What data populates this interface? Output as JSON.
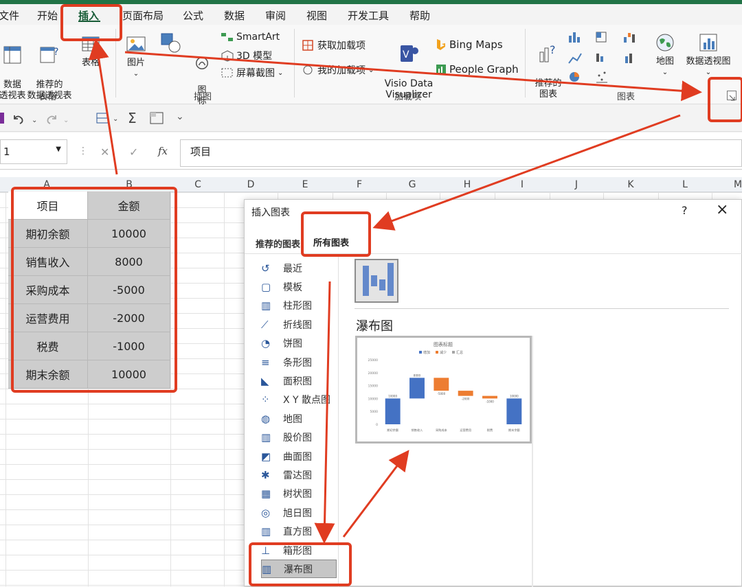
{
  "ribbon_tabs": [
    "文件",
    "开始",
    "插入",
    "页面布局",
    "公式",
    "数据",
    "审阅",
    "视图",
    "开发工具",
    "帮助"
  ],
  "active_tab": "插入",
  "ribbon": {
    "tables_group": {
      "label": "表格",
      "pivot_label": "数据\n透视表",
      "recommended_pivot_label": "推荐的\n数据透视表",
      "table_label": "表格"
    },
    "illustrations_group": {
      "label": "插图",
      "picture_label": "图片",
      "icons_label": "图\n标",
      "smartart": "SmartArt",
      "model3d": "3D 模型",
      "screenshot": "屏幕截图"
    },
    "addins_group": {
      "label": "加载项",
      "get_addins": "获取加载项",
      "my_addins": "我的加载项",
      "visio_label": "Visio Data\nVisualizer",
      "bing_maps": "Bing Maps",
      "people_graph": "People Graph"
    },
    "charts_group": {
      "label": "图表",
      "recommended_charts": "推荐的\n图表",
      "map_label": "地图",
      "pivot_chart_label": "数据透视图"
    }
  },
  "quick_access": {
    "sum_symbol": "Σ"
  },
  "formula_bar": {
    "name_box": "1",
    "fx_label": "fx",
    "content": "项目"
  },
  "columns": [
    "A",
    "B",
    "C",
    "D",
    "E",
    "F",
    "G",
    "H",
    "I",
    "J",
    "K",
    "L",
    "M"
  ],
  "table": {
    "headers": [
      "项目",
      "金额"
    ],
    "rows": [
      [
        "期初余额",
        "10000"
      ],
      [
        "销售收入",
        "8000"
      ],
      [
        "采购成本",
        "-5000"
      ],
      [
        "运营费用",
        "-2000"
      ],
      [
        "税费",
        "-1000"
      ],
      [
        "期末余额",
        "10000"
      ]
    ]
  },
  "dialog": {
    "title": "插入图表",
    "help": "?",
    "close": "×",
    "tabs": [
      "推荐的图表",
      "所有图表"
    ],
    "active_tab": "所有图表",
    "chart_types": [
      "最近",
      "模板",
      "柱形图",
      "折线图",
      "饼图",
      "条形图",
      "面积图",
      "X Y 散点图",
      "地图",
      "股价图",
      "曲面图",
      "雷达图",
      "树状图",
      "旭日图",
      "直方图",
      "箱形图",
      "瀑布图"
    ],
    "selected_type": "瀑布图",
    "preview_heading": "瀑布图",
    "preview": {
      "title": "图表标题",
      "legend": [
        "增加",
        "减少",
        "汇总"
      ],
      "y_ticks": [
        "25000",
        "20000",
        "15000",
        "10000",
        "5000",
        "0"
      ],
      "categories": [
        "期初余额",
        "销售收入",
        "采购成本",
        "运营费用",
        "税费",
        "期末余额"
      ],
      "data_labels": [
        "10000",
        "8000",
        "-5000",
        "-2000",
        "-1000",
        "10000"
      ]
    }
  },
  "colors": {
    "annotation": "#e03c21",
    "excel_green": "#217346",
    "increase": "#4472c4",
    "decrease": "#ed7d31"
  },
  "chart_data": {
    "type": "bar",
    "title": "图表标题",
    "categories": [
      "期初余额",
      "销售收入",
      "采购成本",
      "运营费用",
      "税费",
      "期末余额"
    ],
    "values": [
      10000,
      8000,
      -5000,
      -2000,
      -1000,
      10000
    ],
    "series": [
      {
        "name": "增加",
        "values": [
          10000,
          8000,
          0,
          0,
          0,
          0
        ]
      },
      {
        "name": "减少",
        "values": [
          0,
          0,
          -5000,
          -2000,
          -1000,
          0
        ]
      },
      {
        "name": "汇总",
        "values": [
          0,
          0,
          0,
          0,
          0,
          10000
        ]
      }
    ],
    "ylim": [
      0,
      25000
    ]
  }
}
